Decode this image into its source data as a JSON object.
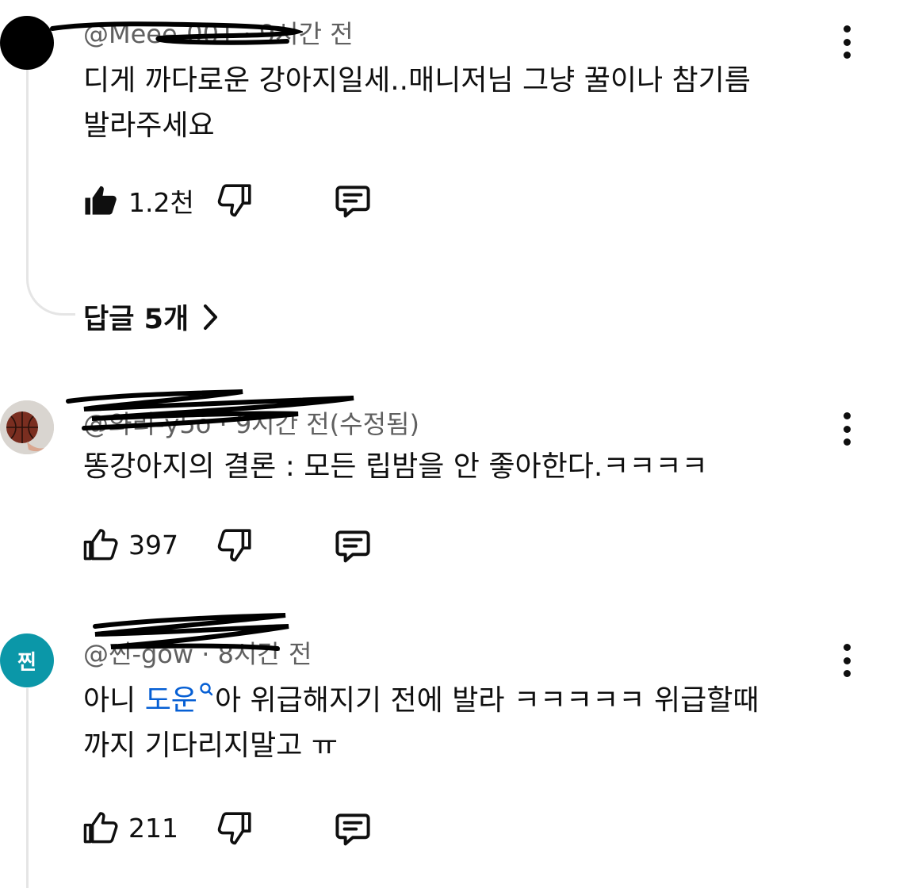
{
  "comments": [
    {
      "meta": "@Meee-001 · 9시간 전",
      "text_line1": "디게 까다로운 강아지일세..매니저님 그냥 꿀이나 참기름",
      "text_line2": "발라주세요",
      "likes": "1.2천",
      "like_state": "liked",
      "replies_label": "답글 5개",
      "avatar_color": "#000000"
    },
    {
      "meta": "@와리-y5o · 9시간 전(수정됨)",
      "text": "똥강아지의 결론 : 모든 립밤을 안 좋아한다.ㅋㅋㅋㅋ",
      "likes": "397",
      "like_state": "none"
    },
    {
      "meta": "@찐-gow · 8시간 전",
      "avatar_letter": "찐",
      "avatar_color": "#0b97a8",
      "text_prefix": "아니 ",
      "mention": "도운",
      "text_suffix": "아 위급해지기 전에 발라 ㅋㅋㅋㅋㅋ 위급할때",
      "text_line2": "까지 기다리지말고 ㅠ",
      "likes": "211",
      "like_state": "none"
    }
  ],
  "icons": {
    "like": "thumbs-up-icon",
    "dislike": "thumbs-down-icon",
    "reply": "reply-icon",
    "more": "more-vert-icon",
    "chevron": "chevron-right-icon",
    "mention": "search-icon"
  },
  "colors": {
    "text": "#0f0f0f",
    "meta": "#606060",
    "mention": "#065fd4",
    "thread_line": "#e5e5e5"
  }
}
